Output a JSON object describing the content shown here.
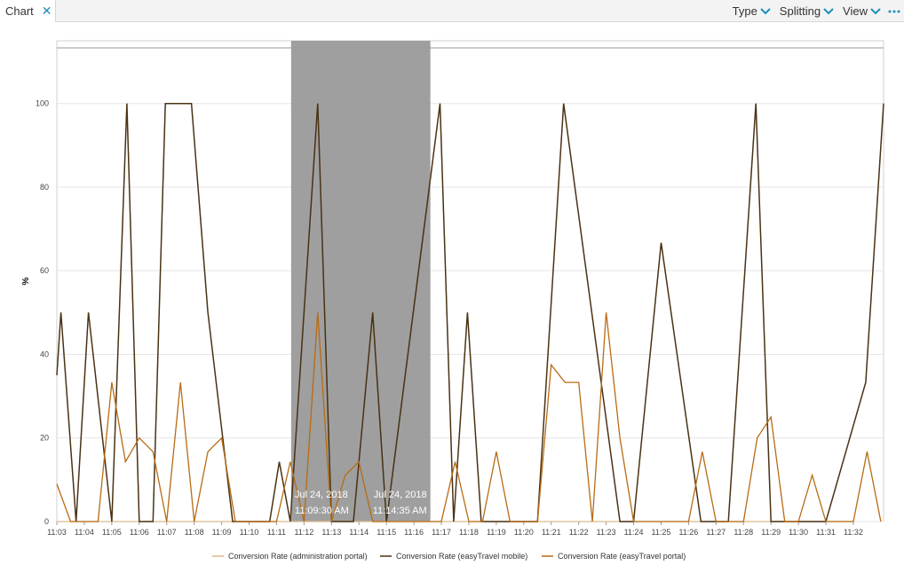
{
  "tab": {
    "label": "Chart"
  },
  "menus": [
    {
      "label": "Type"
    },
    {
      "label": "Splitting"
    },
    {
      "label": "View"
    }
  ],
  "colors": {
    "accent": "#1a8fbe",
    "selection": "#9a9a9a"
  },
  "selection": {
    "start": {
      "date": "Jul 24, 2018",
      "time": "11:09:30 AM"
    },
    "end": {
      "date": "Jul 24, 2018",
      "time": "11:14:35 AM"
    },
    "x_range": [
      11.53,
      16.6
    ]
  },
  "chart_data": {
    "type": "line",
    "ylabel": "%",
    "ylim": [
      0,
      115
    ],
    "yticks": [
      0,
      20,
      40,
      60,
      80,
      100
    ],
    "grid": true,
    "legend_position": "bottom",
    "xticks": [
      "11:03",
      "11:04",
      "11:05",
      "11:06",
      "11:07",
      "11:08",
      "11:09",
      "11:10",
      "11:11",
      "11:12",
      "11:13",
      "11:14",
      "11:15",
      "11:16",
      "11:17",
      "11:18",
      "11:19",
      "11:20",
      "11:21",
      "11:22",
      "11:23",
      "11:24",
      "11:25",
      "11:26",
      "11:27",
      "11:28",
      "11:29",
      "11:30",
      "11:31",
      "11:32"
    ],
    "series": [
      {
        "name": "Conversion Rate (administration portal)",
        "color": "#d9b98a",
        "points": [
          [
            3,
            0
          ],
          [
            3.5,
            0
          ],
          [
            4,
            0
          ],
          [
            5,
            0
          ],
          [
            9.5,
            0
          ],
          [
            10.5,
            0
          ],
          [
            11,
            0
          ],
          [
            13,
            0
          ],
          [
            14,
            0
          ],
          [
            18,
            0
          ],
          [
            20,
            0
          ],
          [
            22,
            0
          ],
          [
            24,
            0
          ],
          [
            26,
            0
          ],
          [
            28,
            0
          ],
          [
            30,
            0
          ],
          [
            32,
            0
          ]
        ]
      },
      {
        "name": "Conversion Rate (easyTravel mobile)",
        "color": "#4a3214",
        "points": [
          [
            3,
            35
          ],
          [
            3.15,
            50
          ],
          [
            3.7,
            0
          ],
          [
            4.15,
            50
          ],
          [
            5,
            0
          ],
          [
            5.55,
            100
          ],
          [
            6,
            0
          ],
          [
            6.5,
            0
          ],
          [
            6.95,
            100
          ],
          [
            7.9,
            100
          ],
          [
            8.5,
            50
          ],
          [
            9.4,
            0
          ],
          [
            10,
            0
          ],
          [
            10.45,
            0
          ],
          [
            10.75,
            0
          ],
          [
            11.1,
            14.3
          ],
          [
            11.5,
            0
          ],
          [
            12.5,
            100
          ],
          [
            13,
            0
          ],
          [
            13.3,
            0
          ],
          [
            13.8,
            0
          ],
          [
            14.5,
            50
          ],
          [
            15,
            0
          ],
          [
            16.95,
            100
          ],
          [
            17.45,
            0
          ],
          [
            17.95,
            50
          ],
          [
            18.45,
            0
          ],
          [
            20.5,
            0
          ],
          [
            21.45,
            100
          ],
          [
            23.5,
            0
          ],
          [
            24,
            0
          ],
          [
            25,
            66.7
          ],
          [
            26.45,
            0
          ],
          [
            27.45,
            0
          ],
          [
            28.45,
            100
          ],
          [
            29,
            0
          ],
          [
            30,
            0
          ],
          [
            31,
            0
          ],
          [
            32.45,
            33.3
          ],
          [
            33.1,
            100
          ]
        ]
      },
      {
        "name": "Conversion Rate (easyTravel portal)",
        "color": "#b86b14",
        "points": [
          [
            3,
            9
          ],
          [
            3.5,
            0
          ],
          [
            4,
            0
          ],
          [
            4.5,
            0
          ],
          [
            5,
            33.3
          ],
          [
            5.5,
            14.3
          ],
          [
            6,
            20
          ],
          [
            6.5,
            16.7
          ],
          [
            7,
            0
          ],
          [
            7.5,
            33.3
          ],
          [
            8,
            0
          ],
          [
            8.5,
            16.7
          ],
          [
            9,
            20
          ],
          [
            9.5,
            0
          ],
          [
            11,
            0
          ],
          [
            11.5,
            14.3
          ],
          [
            12,
            0
          ],
          [
            12.5,
            50
          ],
          [
            13,
            0
          ],
          [
            13.5,
            11.1
          ],
          [
            14,
            14.3
          ],
          [
            14.5,
            0
          ],
          [
            15,
            0
          ],
          [
            15.5,
            0
          ],
          [
            16,
            0
          ],
          [
            17,
            0
          ],
          [
            17.5,
            14.3
          ],
          [
            18,
            0
          ],
          [
            18.5,
            0
          ],
          [
            19,
            16.7
          ],
          [
            19.5,
            0
          ],
          [
            20,
            0
          ],
          [
            20.5,
            0
          ],
          [
            21,
            37.5
          ],
          [
            21.5,
            33.3
          ],
          [
            22,
            33.3
          ],
          [
            22.5,
            0
          ],
          [
            23,
            50
          ],
          [
            23.5,
            20
          ],
          [
            24,
            0
          ],
          [
            25,
            0
          ],
          [
            26,
            0
          ],
          [
            26.5,
            16.7
          ],
          [
            27,
            0
          ],
          [
            27.5,
            0
          ],
          [
            28,
            0
          ],
          [
            28.5,
            20
          ],
          [
            29,
            25
          ],
          [
            29.5,
            0
          ],
          [
            30,
            0
          ],
          [
            30.5,
            11.1
          ],
          [
            31,
            0
          ],
          [
            32,
            0
          ],
          [
            32.5,
            16.7
          ],
          [
            33,
            0
          ]
        ]
      }
    ]
  }
}
